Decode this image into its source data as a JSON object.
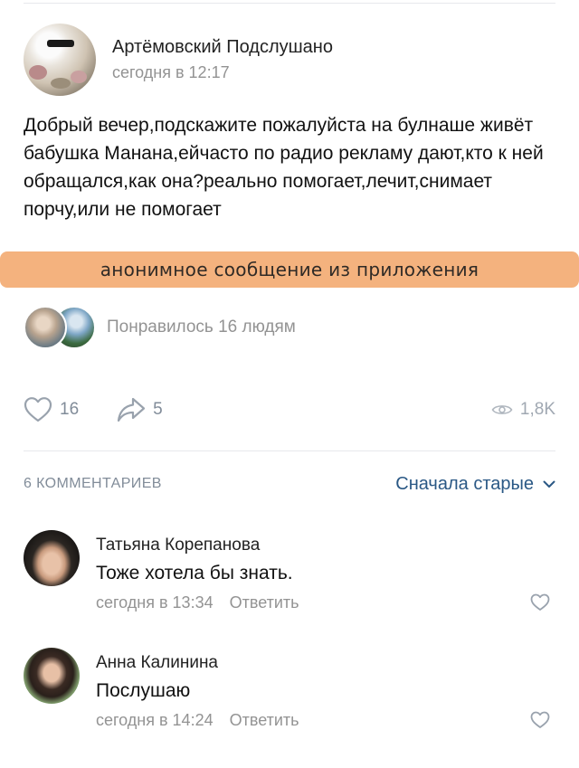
{
  "post": {
    "group_name": "Артёмовский Подслушано",
    "time": "сегодня в 12:17",
    "text": "Добрый вечер,подскажите пожалуйста на булнаше живёт бабушка Манана,ейчасто по радио рекламу дают,кто к ней обращался,как она?реально помогает,лечит,снимает порчу,или не помогает",
    "anon_banner": "анонимное сообщение из приложения",
    "likes_text": "Понравилось 16 людям"
  },
  "actions": {
    "like_count": "16",
    "share_count": "5",
    "views_count": "1,8K"
  },
  "comments_header": {
    "count_label": "6 КОММЕНТАРИЕВ",
    "sort_label": "Сначала старые"
  },
  "comments": [
    {
      "author": "Татьяна Корепанова",
      "text": "Тоже хотела бы знать.",
      "time": "сегодня в 13:34",
      "reply_label": "Ответить"
    },
    {
      "author": "Анна Калинина",
      "text": "Послушаю",
      "time": "сегодня в 14:24",
      "reply_label": "Ответить"
    }
  ],
  "colors": {
    "banner": "#f4b27e",
    "link": "#2a5885",
    "meta": "#939393",
    "icon": "#818c99"
  },
  "icons": [
    "heart-icon",
    "share-icon",
    "eye-icon",
    "chevron-down-icon"
  ]
}
